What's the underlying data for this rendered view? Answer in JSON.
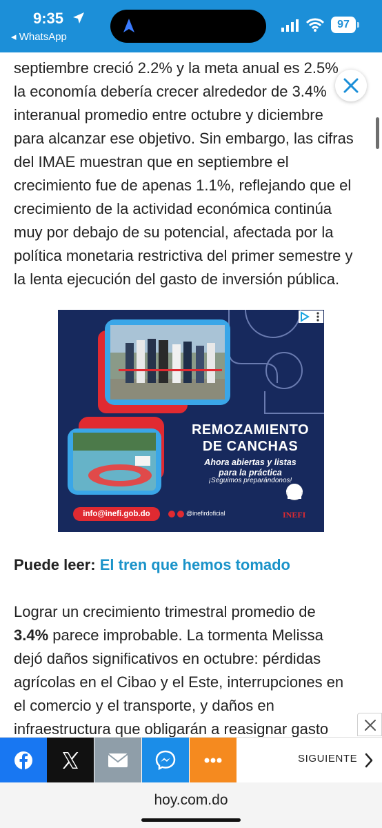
{
  "status_bar": {
    "time": "9:35",
    "back_app": "◂ WhatsApp",
    "battery": "97",
    "bg_color": "#1c8fd8"
  },
  "article": {
    "para1_lines": [
      "septiembre creció 2.2% y la meta anual es 2.5%",
      "la economía debería crecer alrededor de 3.4%",
      "interanual promedio entre octubre y diciembre",
      "para alcanzar ese objetivo. Sin embargo, las cifras",
      "del IMAE muestran que en septiembre el",
      "crecimiento fue de apenas 1.1%, reflejando que el",
      "crecimiento de la actividad económica continúa",
      "muy por debajo de su potencial, afectada por la",
      "política monetaria restrictiva del primer semestre y",
      "la lenta ejecución del gasto de inversión pública."
    ],
    "read_also_label": "Puede leer:",
    "read_also_link": "El tren que hemos tomado",
    "para2": {
      "l1": "Lograr un crecimiento trimestral promedio de",
      "l2_bold": "3.4%",
      "l2_rest": " parece improbable. La tormenta Melissa",
      "l3": "dejó daños significativos en octubre: pérdidas",
      "l4": "agrícolas en el Cibao y el Este, interrupciones en",
      "l5": "el comercio y el transporte, y daños en",
      "l6": "infraestructura que obligarán a reasignar gasto"
    }
  },
  "ad": {
    "title_line1": "REMOZAMIENTO",
    "title_line2": "DE CANCHAS",
    "subtitle_line1": "Ahora abiertas y listas",
    "subtitle_line2": "para la práctica",
    "tagline": "¡Seguimos preparándonos!",
    "email": "info@inefi.gob.do",
    "social_handle": "@inefirdoficial",
    "logo_text": "INEFI"
  },
  "share_bar": {
    "icons": [
      "facebook-icon",
      "x-icon",
      "mail-icon",
      "messenger-icon",
      "more-icon"
    ],
    "next_label": "SIGUIENTE",
    "colors": {
      "facebook": "#1877f2",
      "x": "#111111",
      "mail": "#8f9ea9",
      "messenger": "#1b8de8",
      "more": "#f58a1f"
    }
  },
  "url_bar": {
    "url": "hoy.com.do"
  }
}
